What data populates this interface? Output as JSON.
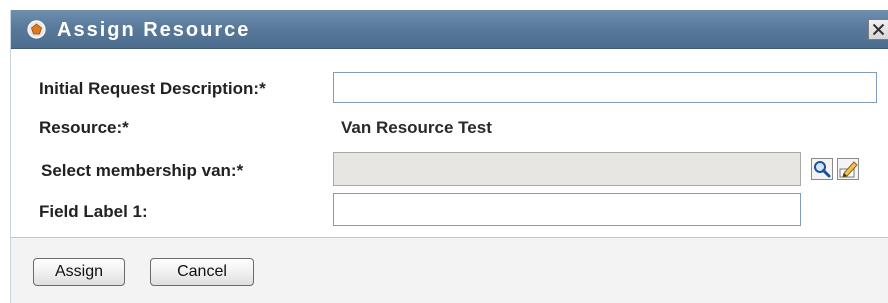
{
  "dialog": {
    "title": "Assign Resource",
    "title_icon": "resource-badge-icon",
    "close_icon": "close-icon"
  },
  "form": {
    "description": {
      "label": "Initial Request Description:*",
      "value": ""
    },
    "resource": {
      "label": "Resource:*",
      "value": "Van Resource Test"
    },
    "membership": {
      "label": "Select membership van:*",
      "value": "",
      "lookup_icon": "magnifier-icon",
      "edit_icon": "edit-pencil-icon"
    },
    "field1": {
      "label": "Field Label 1:",
      "value": ""
    }
  },
  "buttons": {
    "assign_label": "Assign",
    "cancel_label": "Cancel"
  },
  "colors": {
    "titlebar": "#5a7a9c",
    "input_border": "#7f9db9",
    "disabled_input": "#e7e6e2",
    "button_bar": "#f3f3f3"
  }
}
